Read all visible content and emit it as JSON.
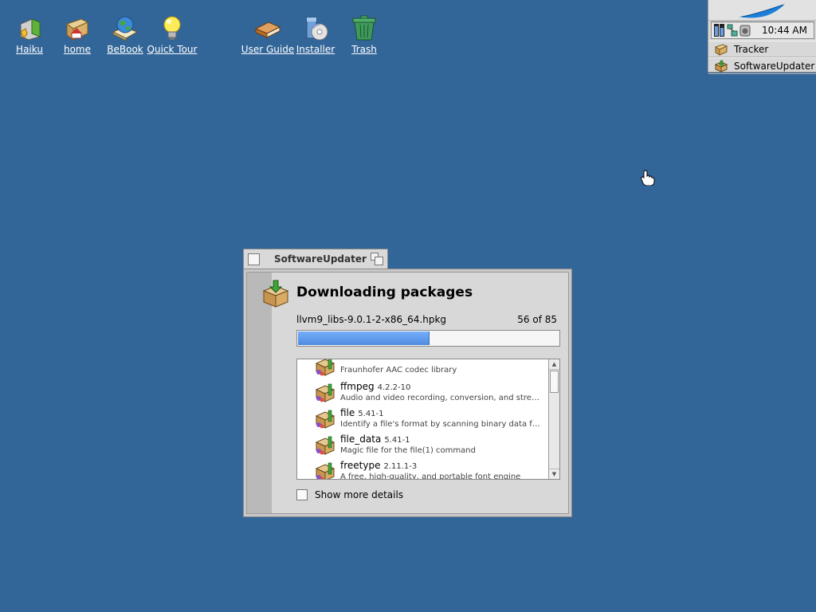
{
  "desktop": {
    "icons": [
      {
        "label": "Haiku",
        "icon": "haiku-volume-icon"
      },
      {
        "label": "home",
        "icon": "home-folder-icon"
      },
      {
        "label": "BeBook",
        "icon": "bebook-globe-icon"
      },
      {
        "label": "Quick Tour",
        "icon": "lightbulb-icon"
      },
      {
        "label": "User Guide",
        "icon": "book-icon"
      },
      {
        "label": "Installer",
        "icon": "installer-icon"
      },
      {
        "label": "Trash",
        "icon": "trash-icon"
      }
    ]
  },
  "deskbar": {
    "clock": "10:44 AM",
    "apps": [
      {
        "label": "Tracker",
        "icon": "tracker-icon"
      },
      {
        "label": "SoftwareUpdater",
        "icon": "software-updater-icon"
      }
    ]
  },
  "window": {
    "title": "SoftwareUpdater",
    "heading": "Downloading packages",
    "current_package": "llvm9_libs-9.0.1-2-x86_64.hpkg",
    "progress_text": "56 of 85",
    "progress_fraction": 0.5,
    "packages": [
      {
        "name": "",
        "version": "",
        "description": "Fraunhofer AAC codec library"
      },
      {
        "name": "ffmpeg",
        "version": "4.2.2-10",
        "description": "Audio and video recording, conversion, and streaming li..."
      },
      {
        "name": "file",
        "version": "5.41-1",
        "description": "Identify a file's format by scanning binary data for patterns"
      },
      {
        "name": "file_data",
        "version": "5.41-1",
        "description": "Magic file for the file(1) command"
      },
      {
        "name": "freetype",
        "version": "2.11.1-3",
        "description": "A free, high-quality, and portable font engine"
      }
    ],
    "show_details_label": "Show more details"
  },
  "colors": {
    "desktop": "#336698",
    "progress_fill": "#5b97ee"
  }
}
